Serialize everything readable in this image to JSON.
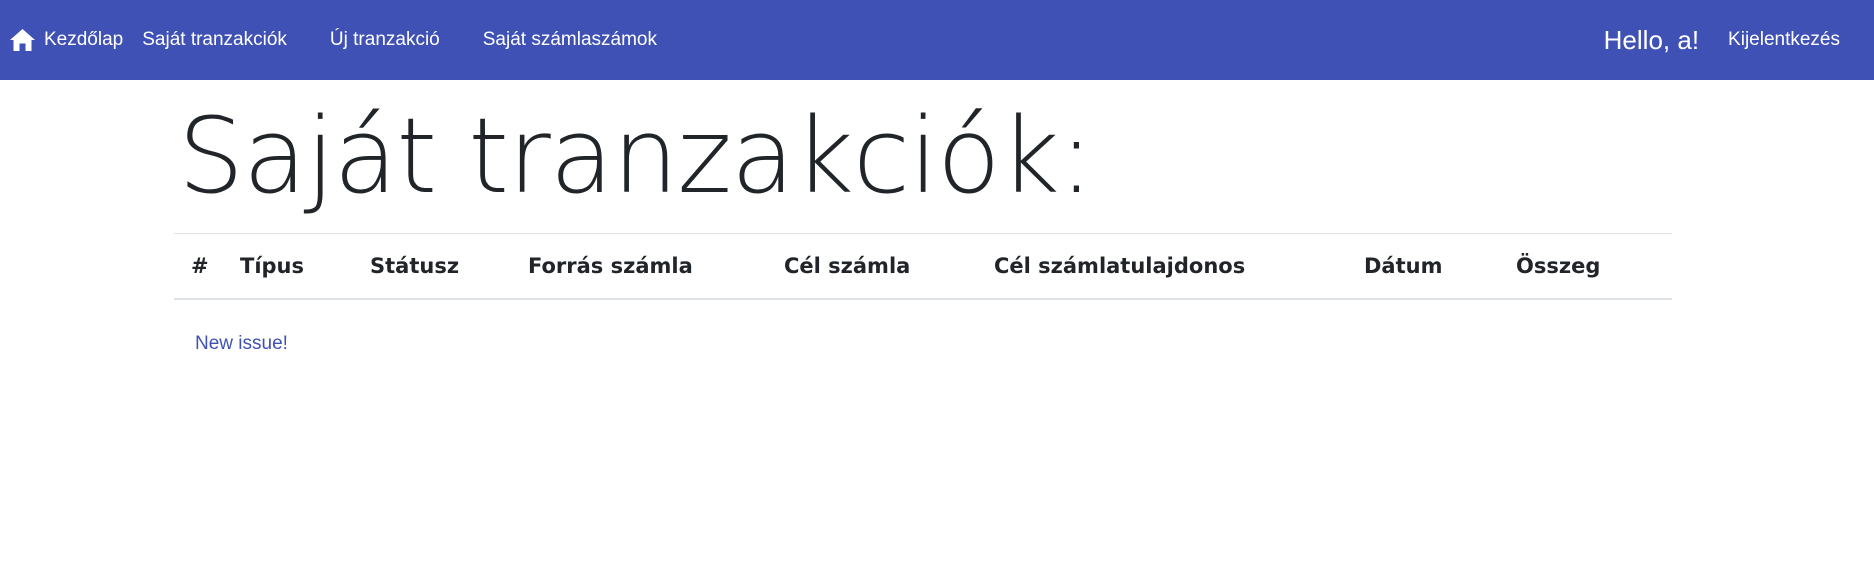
{
  "navbar": {
    "home_label": "Kezdőlap",
    "links": [
      {
        "label": "Saját tranzakciók"
      },
      {
        "label": "Új tranzakció"
      },
      {
        "label": "Saját számlaszámok"
      }
    ],
    "greeting": "Hello, a!",
    "logout_label": "Kijelentkezés",
    "background_color": "#3f51b5"
  },
  "main": {
    "title": "Saját tranzakciók:",
    "table": {
      "columns": [
        "#",
        "Típus",
        "Státusz",
        "Forrás számla",
        "Cél számla",
        "Cél számlatulajdonos",
        "Dátum",
        "Összeg"
      ],
      "rows": []
    },
    "new_issue_label": "New issue!",
    "link_color": "#3f51b5"
  }
}
